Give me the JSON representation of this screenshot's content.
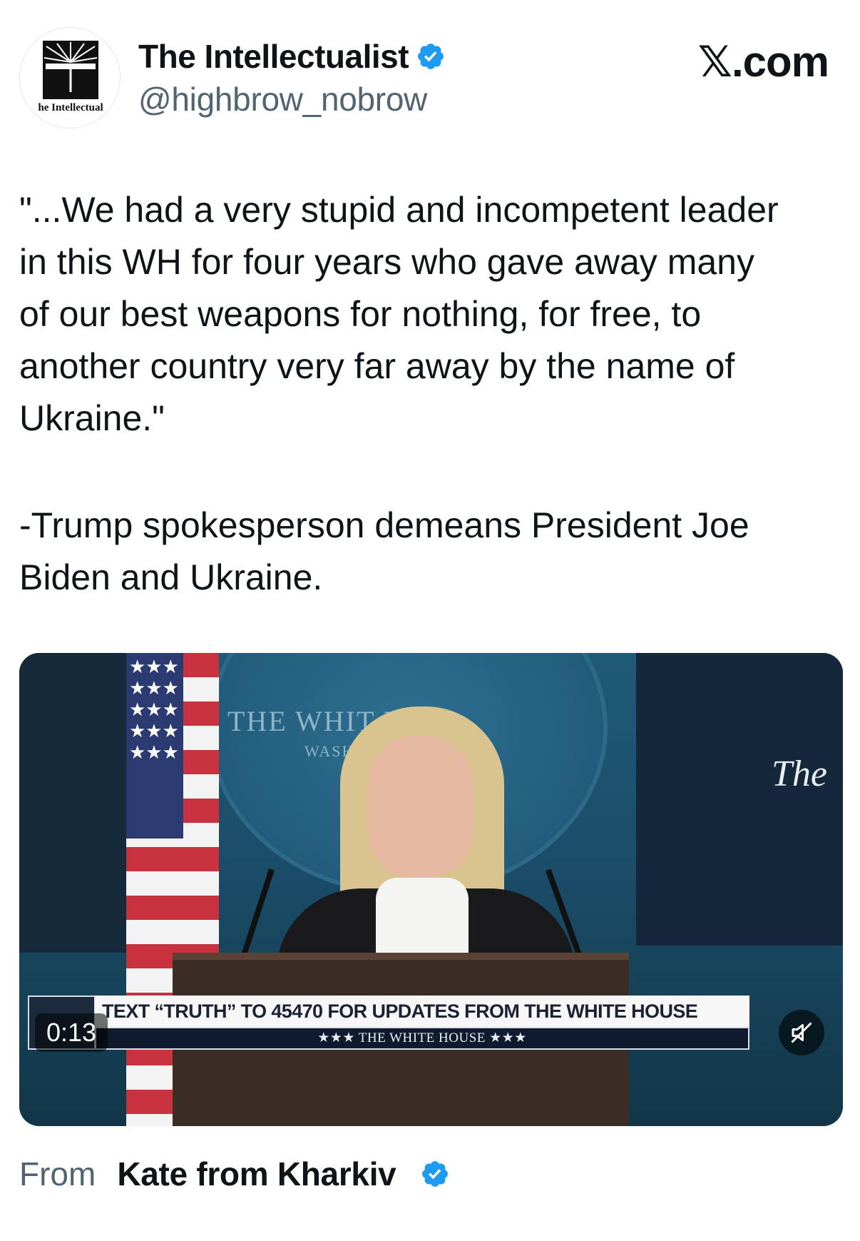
{
  "header": {
    "avatar_text": "he Intellectual",
    "display_name": "The Intellectualist",
    "handle": "@highbrow_nobrow",
    "brand": "𝕏.com",
    "verified_color": "#1d9bf0"
  },
  "tweet": {
    "quote": "\"...We had a very stupid and incompetent leader\nin this WH for four years who gave away many\nof our best weapons for nothing, for free, to\nanother country very far away by the name of\nUkraine.\"",
    "attribution": "-Trump spokesperson demeans President Joe\nBiden and Ukraine."
  },
  "video": {
    "backdrop_text": "THE WHIT      USE",
    "backdrop_sub": "WASHI",
    "side_text": "The",
    "flag_stars": "★★★★★★★★★★★★★★★",
    "chyron_main": "TEXT “TRUTH” TO 45470 FOR UPDATES FROM THE WHITE HOUSE",
    "chyron_sub": "★★★  THE WHITE HOUSE  ★★★",
    "timestamp": "0:13",
    "mute_icon": "muted-speaker-icon"
  },
  "footer": {
    "from_label": "From",
    "from_name": "Kate from Kharkiv"
  }
}
